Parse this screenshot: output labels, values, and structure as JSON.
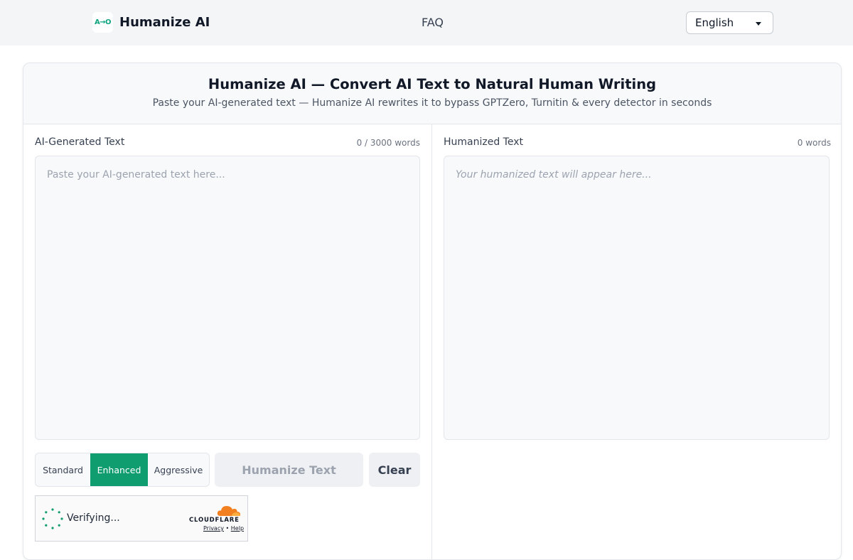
{
  "header": {
    "logo_text": "A→O",
    "brand_name": "Humanize AI",
    "nav_faq": "FAQ",
    "language": "English"
  },
  "hero": {
    "title": "Humanize AI — Convert AI Text to Natural Human Writing",
    "subtitle": "Paste your AI-generated text — Humanize AI rewrites it to bypass GPTZero, Turnitin & every detector in seconds"
  },
  "input_pane": {
    "label": "AI-Generated Text",
    "count": "0 / 3000 words",
    "placeholder": "Paste your AI-generated text here..."
  },
  "output_pane": {
    "label": "Humanized Text",
    "count": "0 words",
    "placeholder": "Your humanized text will appear here..."
  },
  "modes": [
    {
      "label": "Standard",
      "active": false
    },
    {
      "label": "Enhanced",
      "active": true
    },
    {
      "label": "Aggressive",
      "active": false
    }
  ],
  "actions": {
    "humanize": "Humanize Text",
    "clear": "Clear"
  },
  "captcha": {
    "status": "Verifying...",
    "brand": "CLOUDFLARE",
    "privacy": "Privacy",
    "separator": "•",
    "help": "Help"
  },
  "colors": {
    "accent": "#0f9d6f",
    "header_bg": "#f4f5f7",
    "panel_bg": "#f8f9fb",
    "cloudflare_orange": "#f38020"
  }
}
